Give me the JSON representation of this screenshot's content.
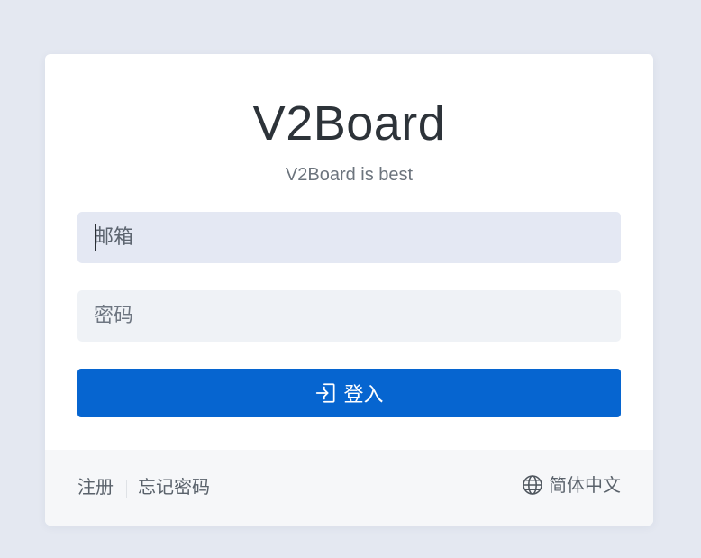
{
  "brand": {
    "title": "V2Board",
    "subtitle": "V2Board is best"
  },
  "form": {
    "email": {
      "placeholder": "邮箱",
      "value": ""
    },
    "password": {
      "placeholder": "密码",
      "value": ""
    },
    "login_label": "登入",
    "login_icon": "sign-in-icon"
  },
  "footer": {
    "register_label": "注册",
    "forgot_label": "忘记密码",
    "language_label": "简体中文",
    "language_icon": "globe-icon"
  },
  "colors": {
    "background": "#e4e8f1",
    "primary": "#0665d0",
    "card": "#ffffff",
    "footer": "#f6f7f9"
  }
}
